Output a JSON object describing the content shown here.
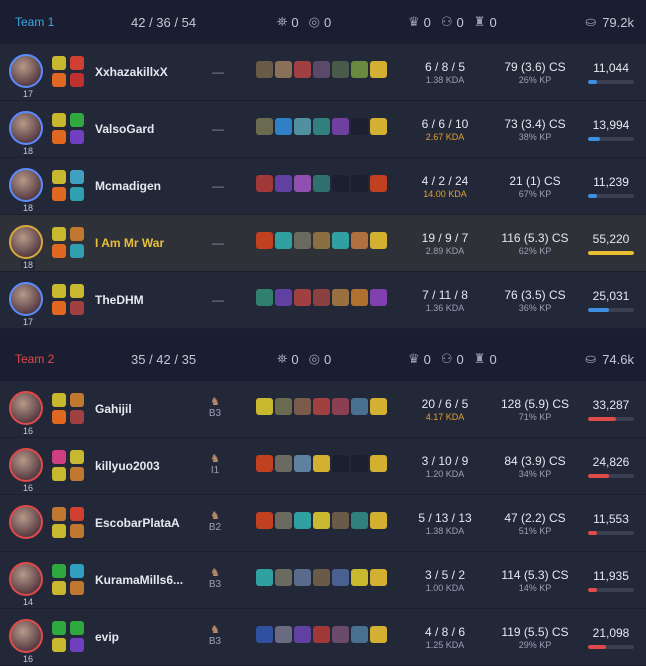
{
  "teams": [
    {
      "name": "Team 1",
      "name_color": "#3da8e6",
      "kda": "42 / 36 / 54",
      "towers": "0",
      "inhibs": "0",
      "barons": "0",
      "dragons": "0",
      "heralds": "0",
      "gold": "79.2k",
      "side": "blue",
      "players": [
        {
          "level": "17",
          "name": "XxhazakillxX",
          "role": "—",
          "badge": "",
          "badge_sub": "",
          "kda": "6 / 8 / 5",
          "ratio": "1.38 KDA",
          "ratio_color": "gray",
          "cs": "79 (3.6) CS",
          "kp": "26% KP",
          "dmg": "11,044",
          "dmg_ratio": 0.2,
          "spell_colors": [
            "#c8b830",
            "#d04030",
            "#e06820",
            "#c03030"
          ],
          "item_colors": [
            "#6a5a48",
            "#8a7058",
            "#a04040",
            "#5a4a6a",
            "#4a5a48",
            "#6a8a40",
            "#d4b030"
          ],
          "highlight": false
        },
        {
          "level": "18",
          "name": "ValsoGard",
          "role": "—",
          "badge": "",
          "badge_sub": "",
          "kda": "6 / 6 / 10",
          "ratio": "2.67 KDA",
          "ratio_color": "orange",
          "cs": "73 (3.4) CS",
          "kp": "38% KP",
          "dmg": "13,994",
          "dmg_ratio": 0.25,
          "spell_colors": [
            "#c8b830",
            "#30a840",
            "#e06820",
            "#7040c0"
          ],
          "item_colors": [
            "#6a6a50",
            "#3080c8",
            "#5090a0",
            "#308080",
            "#7040a0",
            "#1a2030",
            "#d4b030"
          ],
          "highlight": false
        },
        {
          "level": "18",
          "name": "Mcmadigen",
          "role": "—",
          "badge": "",
          "badge_sub": "",
          "kda": "4 / 2 / 24",
          "ratio": "14.00 KDA",
          "ratio_color": "orange",
          "cs": "21 (1) CS",
          "kp": "67% KP",
          "dmg": "11,239",
          "dmg_ratio": 0.2,
          "spell_colors": [
            "#c8b830",
            "#40a0c0",
            "#e06820",
            "#30a0b0"
          ],
          "item_colors": [
            "#a03838",
            "#6040a0",
            "#9050b0",
            "#307070",
            "#1a2030",
            "#1a2030",
            "#c04020"
          ],
          "highlight": false
        },
        {
          "level": "18",
          "name": "I Am Mr War",
          "role": "—",
          "badge": "",
          "badge_sub": "",
          "kda": "19 / 9 / 7",
          "ratio": "2.89 KDA",
          "ratio_color": "gray",
          "cs": "116 (5.3) CS",
          "kp": "62% KP",
          "dmg": "55,220",
          "dmg_ratio": 1.0,
          "spell_colors": [
            "#c8b830",
            "#c07830",
            "#e06820",
            "#30a0b0"
          ],
          "item_colors": [
            "#c04020",
            "#30a0a0",
            "#6a6a60",
            "#8a7040",
            "#30a0a0",
            "#b07040",
            "#d4b030"
          ],
          "highlight": true
        },
        {
          "level": "17",
          "name": "TheDHM",
          "role": "—",
          "badge": "",
          "badge_sub": "",
          "kda": "7 / 11 / 8",
          "ratio": "1.36 KDA",
          "ratio_color": "gray",
          "cs": "76 (3.5) CS",
          "kp": "36% KP",
          "dmg": "25,031",
          "dmg_ratio": 0.45,
          "spell_colors": [
            "#c8b830",
            "#c8b830",
            "#e06820",
            "#a04040"
          ],
          "item_colors": [
            "#308070",
            "#6040a0",
            "#a04040",
            "#8a4040",
            "#9a7040",
            "#b07030",
            "#8040b0"
          ],
          "highlight": false
        }
      ]
    },
    {
      "name": "Team 2",
      "name_color": "#e24a4a",
      "kda": "35 / 42 / 35",
      "towers": "0",
      "inhibs": "0",
      "barons": "0",
      "dragons": "0",
      "heralds": "0",
      "gold": "74.6k",
      "side": "red",
      "players": [
        {
          "level": "16",
          "name": "Gahijil",
          "role": "",
          "badge": "B3",
          "kda": "20 / 6 / 5",
          "ratio": "4.17 KDA",
          "ratio_color": "orange",
          "cs": "128 (5.9) CS",
          "kp": "71% KP",
          "dmg": "33,287",
          "dmg_ratio": 0.6,
          "spell_colors": [
            "#c8b830",
            "#c07830",
            "#e06820",
            "#a04040"
          ],
          "item_colors": [
            "#c8b830",
            "#6a6a50",
            "#7a5a48",
            "#a04040",
            "#8a4050",
            "#4a7090",
            "#d4b030"
          ],
          "highlight": false
        },
        {
          "level": "16",
          "name": "killyuo2003",
          "role": "",
          "badge": "I1",
          "kda": "3 / 10 / 9",
          "ratio": "1.20 KDA",
          "ratio_color": "gray",
          "cs": "84 (3.9) CS",
          "kp": "34% KP",
          "dmg": "24,826",
          "dmg_ratio": 0.45,
          "spell_colors": [
            "#d04080",
            "#c8b830",
            "#c8b830",
            "#c07830"
          ],
          "item_colors": [
            "#c04020",
            "#6a6a60",
            "#6080a0",
            "#d4b030",
            "#1a2030",
            "#1a2030",
            "#d4b030"
          ],
          "highlight": false
        },
        {
          "level": "",
          "name": "EscobarPlataA",
          "role": "",
          "badge": "B2",
          "kda": "5 / 13 / 13",
          "ratio": "1.38 KDA",
          "ratio_color": "gray",
          "cs": "47 (2.2) CS",
          "kp": "51% KP",
          "dmg": "11,553",
          "dmg_ratio": 0.2,
          "spell_colors": [
            "#c07830",
            "#d04030",
            "#c8b830",
            "#c07830"
          ],
          "item_colors": [
            "#c04020",
            "#6a6a60",
            "#30a0a0",
            "#c8b830",
            "#6a5a48",
            "#308080",
            "#d4b030"
          ],
          "highlight": false
        },
        {
          "level": "14",
          "name": "KuramaMills6...",
          "role": "",
          "badge": "B3",
          "kda": "3 / 5 / 2",
          "ratio": "1.00 KDA",
          "ratio_color": "gray",
          "cs": "114 (5.3) CS",
          "kp": "14% KP",
          "dmg": "11,935",
          "dmg_ratio": 0.2,
          "spell_colors": [
            "#30a840",
            "#30a0c0",
            "#c8b830",
            "#c07830"
          ],
          "item_colors": [
            "#30a0a0",
            "#6a6a60",
            "#5a6a8a",
            "#6a5a48",
            "#4a6090",
            "#c8b830",
            "#d4b030"
          ],
          "highlight": false
        },
        {
          "level": "16",
          "name": "evip",
          "role": "",
          "badge": "B3",
          "kda": "4 / 8 / 6",
          "ratio": "1.25 KDA",
          "ratio_color": "gray",
          "cs": "119 (5.5) CS",
          "kp": "29% KP",
          "dmg": "21,098",
          "dmg_ratio": 0.4,
          "spell_colors": [
            "#30a840",
            "#30a840",
            "#c8b830",
            "#7040c0"
          ],
          "item_colors": [
            "#3050a0",
            "#6a6a80",
            "#6040a0",
            "#a03838",
            "#6a4a6a",
            "#4a7090",
            "#d4b030"
          ],
          "highlight": false
        }
      ]
    }
  ],
  "colors": {
    "blue_bar": "#3d8fe0",
    "red_bar": "#e04a4a",
    "gold_bar": "#e8c030"
  }
}
